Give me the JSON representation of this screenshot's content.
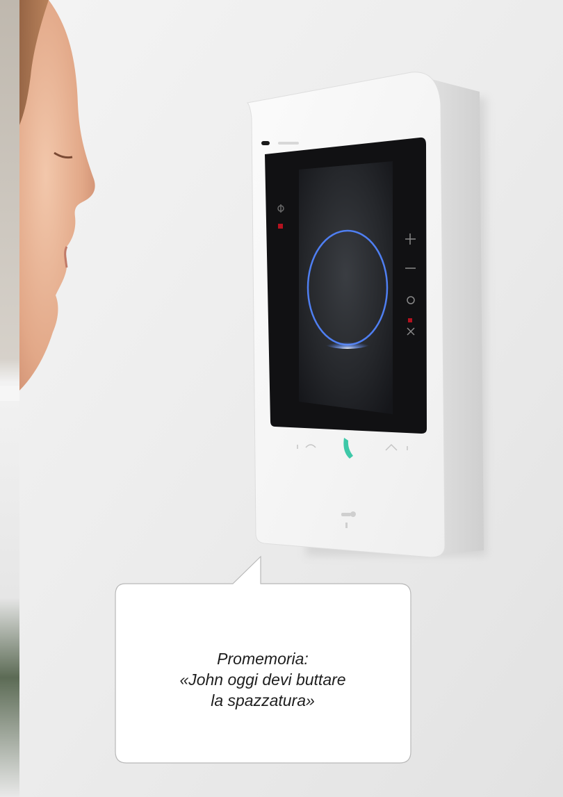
{
  "bubble": {
    "line1": "Promemoria:",
    "line2": "«John oggi devi buttare",
    "line3": "la spazzatura»"
  },
  "colors": {
    "wall": "#ececec",
    "device_body": "#f7f7f7",
    "screen": "#121212",
    "ring": "#4f7ff2",
    "handset_icon": "#3ec8a8",
    "indicator": "#d0112b"
  }
}
